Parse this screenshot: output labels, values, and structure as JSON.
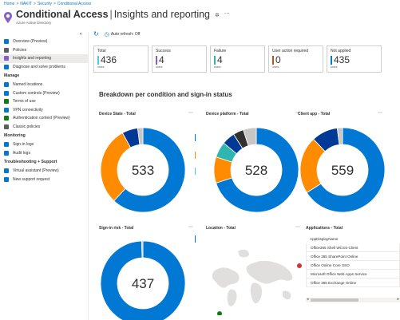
{
  "breadcrumb": [
    "Home",
    "NAKIT",
    "Security",
    "Conditional Access"
  ],
  "header": {
    "title_bold": "Conditional Access",
    "title_rest": "Insights and reporting",
    "subtitle": "Azure Active Directory"
  },
  "sidebar": {
    "items_top": [
      {
        "label": "Overview (Preview)",
        "icon": "info-icon",
        "color": "#0078d4"
      },
      {
        "label": "Policies",
        "icon": "list-icon",
        "color": "#605e5c"
      },
      {
        "label": "Insights and reporting",
        "icon": "lightbulb-icon",
        "color": "#8661c5",
        "active": true
      },
      {
        "label": "Diagnose and solve problems",
        "icon": "wrench-icon",
        "color": "#0078d4"
      }
    ],
    "section_manage": "Manage",
    "items_manage": [
      {
        "label": "Named locations",
        "icon": "location-icon",
        "color": "#0078d4"
      },
      {
        "label": "Custom controls (Preview)",
        "icon": "controls-icon",
        "color": "#0078d4"
      },
      {
        "label": "Terms of use",
        "icon": "document-check-icon",
        "color": "#107c10"
      },
      {
        "label": "VPN connectivity",
        "icon": "globe-icon",
        "color": "#0078d4"
      },
      {
        "label": "Authentication context (Preview)",
        "icon": "shield-people-icon",
        "color": "#107c10"
      },
      {
        "label": "Classic policies",
        "icon": "list-icon",
        "color": "#605e5c"
      }
    ],
    "section_monitoring": "Monitoring",
    "items_monitoring": [
      {
        "label": "Sign-in logs",
        "icon": "signin-icon",
        "color": "#0078d4"
      },
      {
        "label": "Audit logs",
        "icon": "audit-icon",
        "color": "#0078d4"
      }
    ],
    "section_support": "Troubleshooting + Support",
    "items_support": [
      {
        "label": "Virtual assistant (Preview)",
        "icon": "assistant-icon",
        "color": "#0078d4"
      },
      {
        "label": "New support request",
        "icon": "support-person-icon",
        "color": "#0078d4"
      }
    ]
  },
  "toolbar": {
    "auto_refresh": "Auto refresh: Off"
  },
  "tiles": [
    {
      "label": "Total",
      "value": "436",
      "unit": "users",
      "color": "#50c7e5"
    },
    {
      "label": "Success",
      "value": "4",
      "unit": "users",
      "color": "#8661c5"
    },
    {
      "label": "Failure",
      "value": "4",
      "unit": "users",
      "color": "#2fb6b0"
    },
    {
      "label": "User action required",
      "value": "0",
      "unit": "users",
      "color": "#ca5010"
    },
    {
      "label": "Not applied",
      "value": "435",
      "unit": "users",
      "color": "#0078d4"
    }
  ],
  "section_title": "Breakdown per condition and sign-in status",
  "panels": [
    {
      "title": "Device State - Total",
      "total": "533"
    },
    {
      "title": "Device platform - Total",
      "total": "528"
    },
    {
      "title": "Client app - Total",
      "total": "559"
    },
    {
      "title": "Sign-in risk - Total",
      "total": "437"
    },
    {
      "title": "Location - Total"
    },
    {
      "title": "Applications - Total"
    }
  ],
  "donut_colors": {
    "blue": "#0078d4",
    "orange": "#ff8c00",
    "navy": "#003a96",
    "teal": "#2fb6b0",
    "light": "#c8c6c4",
    "cyan": "#50c7e5",
    "dark": "#323130"
  },
  "applications_table": {
    "header": "AppDisplayName",
    "rows": [
      "Office365 Shell WCSS-Client",
      "Office 365 SharePoint Online",
      "Office Online Core SSO",
      "Microsoft Office Web Apps Service",
      "Office 365 Exchange Online"
    ]
  }
}
